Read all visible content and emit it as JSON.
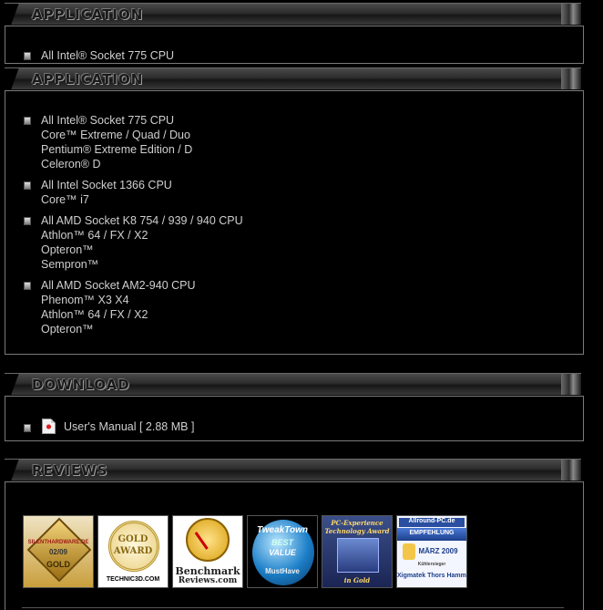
{
  "application_partial": {
    "title": "APPLICATION",
    "first_item": "All Intel® Socket 775 CPU"
  },
  "application": {
    "title": "APPLICATION",
    "items": [
      {
        "lines": [
          "All Intel® Socket 775 CPU",
          "Core™ Extreme / Quad / Duo",
          "Pentium® Extreme Edition / D",
          "Celeron® D"
        ]
      },
      {
        "lines": [
          "All Intel Socket 1366 CPU",
          "Core™ i7"
        ]
      },
      {
        "lines": [
          "All AMD Socket K8 754 / 939 / 940 CPU",
          "Athlon™ 64 / FX / X2",
          "Opteron™",
          "Sempron™"
        ]
      },
      {
        "lines": [
          "All AMD Socket AM2-940 CPU",
          "Phenom™ X3 X4",
          "Athlon™ 64 / FX / X2",
          "Opteron™"
        ]
      }
    ]
  },
  "download": {
    "title": "DOWNLOAD",
    "manual_label": "User's Manual",
    "manual_size": "[ 2.88 MB ]",
    "icon": "pdf-file-icon"
  },
  "reviews": {
    "title": "REVIEWS",
    "awards": [
      {
        "name": "silenthardware-gold",
        "text": [
          "SILENTHARDWARE.DE",
          "02/09",
          "GOLD"
        ]
      },
      {
        "name": "technic3d-gold-award",
        "text": [
          "GOLD",
          "AWARD",
          "TECHNIC3D.COM"
        ]
      },
      {
        "name": "benchmark-reviews",
        "text": [
          "Benchmark",
          "Reviews.com"
        ]
      },
      {
        "name": "tweaktown-best-value",
        "text": [
          "TweakTown",
          "BEST",
          "VALUE",
          "MustHave"
        ]
      },
      {
        "name": "pc-experience-award",
        "text": [
          "PC-Experience",
          "Technology Award",
          "in Gold"
        ]
      },
      {
        "name": "allround-pc-empfehlung",
        "text": [
          "Allround-PC.de",
          "EMPFEHLUNG",
          "MÄRZ 2009",
          "Kühlersieger",
          "Xigmatek Thors Hammer"
        ]
      }
    ]
  }
}
